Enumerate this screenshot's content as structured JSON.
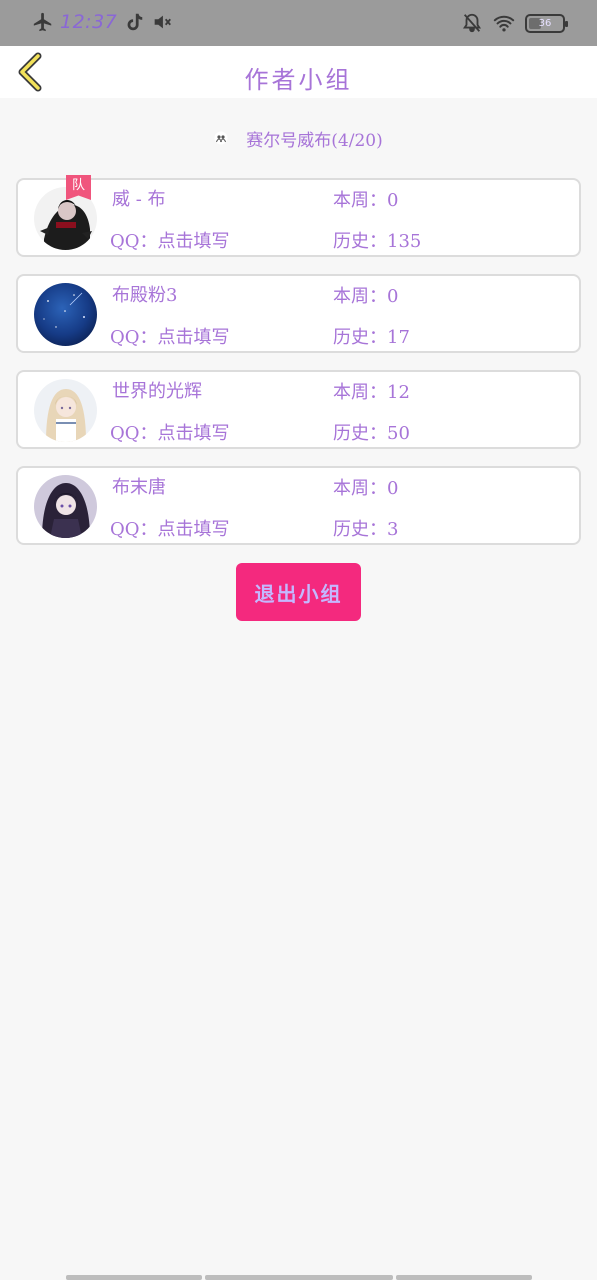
{
  "status_bar": {
    "time": "12:37",
    "battery": "36"
  },
  "header": {
    "title": "作者小组",
    "back_icon": "chevron-left-icon"
  },
  "group": {
    "name": "赛尔号威布(4/20)"
  },
  "members": [
    {
      "name": "威 - 布",
      "badge": "队",
      "qq_label": "QQ：",
      "qq_value": "点击填写",
      "week_label": "本周：",
      "week_value": "0",
      "history_label": "历史：",
      "history_value": "135"
    },
    {
      "name": "布殿粉3",
      "qq_label": "QQ：",
      "qq_value": "点击填写",
      "week_label": "本周：",
      "week_value": "0",
      "history_label": "历史：",
      "history_value": "17"
    },
    {
      "name": "世界的光辉",
      "qq_label": "QQ：",
      "qq_value": "点击填写",
      "week_label": "本周：",
      "week_value": "12",
      "history_label": "历史：",
      "history_value": "50"
    },
    {
      "name": "布末唐",
      "qq_label": "QQ：",
      "qq_value": "点击填写",
      "week_label": "本周：",
      "week_value": "0",
      "history_label": "历史：",
      "history_value": "3"
    }
  ],
  "actions": {
    "quit_label": "退出小组"
  },
  "colors": {
    "accent_text": "#a774d8",
    "quit_button": "#f4297e",
    "badge": "#f0557d",
    "status_bar": "#9b9b9b"
  }
}
